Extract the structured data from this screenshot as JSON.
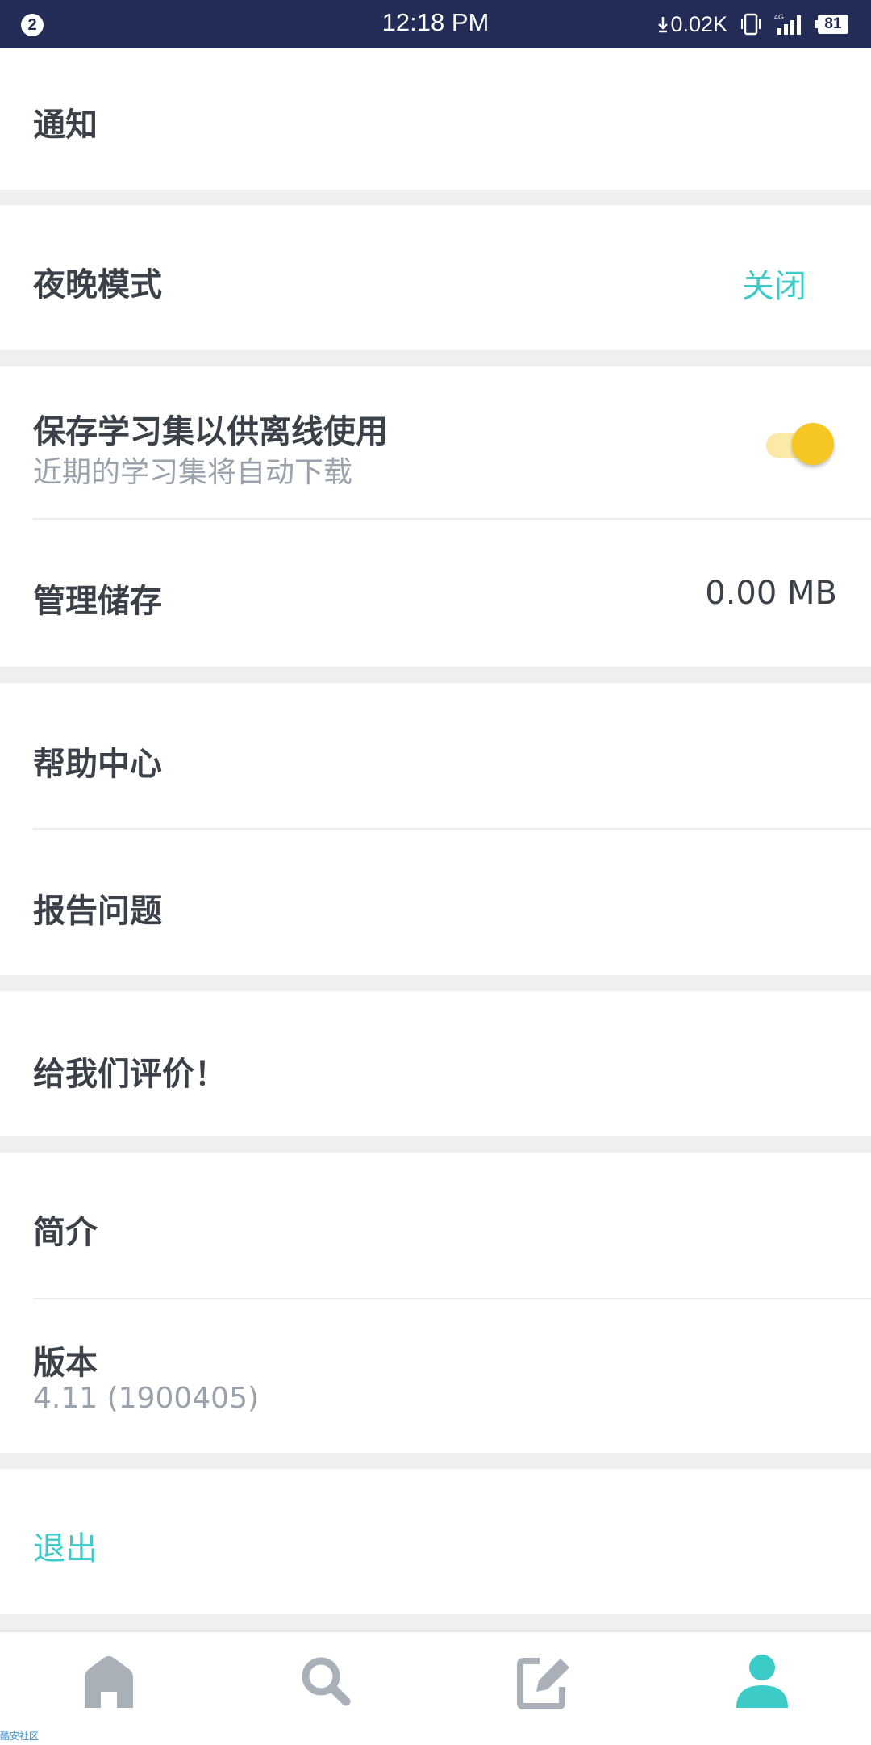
{
  "status_bar": {
    "notification_count": "2",
    "time": "12:18 PM",
    "net_speed": "0.02K",
    "battery": "81"
  },
  "settings": {
    "notifications_label": "通知",
    "night_mode_label": "夜晚模式",
    "night_mode_value": "关闭",
    "offline_label": "保存学习集以供离线使用",
    "offline_sub": "近期的学习集将自动下载",
    "offline_enabled": true,
    "storage_label": "管理储存",
    "storage_value": "0.00 MB",
    "help_label": "帮助中心",
    "report_label": "报告问题",
    "rate_label": "给我们评价！",
    "about_label": "简介",
    "version_label": "版本",
    "version_value": "4.11 (1900405)",
    "logout_label": "退出"
  },
  "bottom_nav": {
    "items": [
      "home-icon",
      "search-icon",
      "edit-icon",
      "profile-icon"
    ],
    "active_index": 3,
    "active_color": "#3ccbc6",
    "inactive_color": "#a9b0b8"
  },
  "watermark": "酷安社区"
}
